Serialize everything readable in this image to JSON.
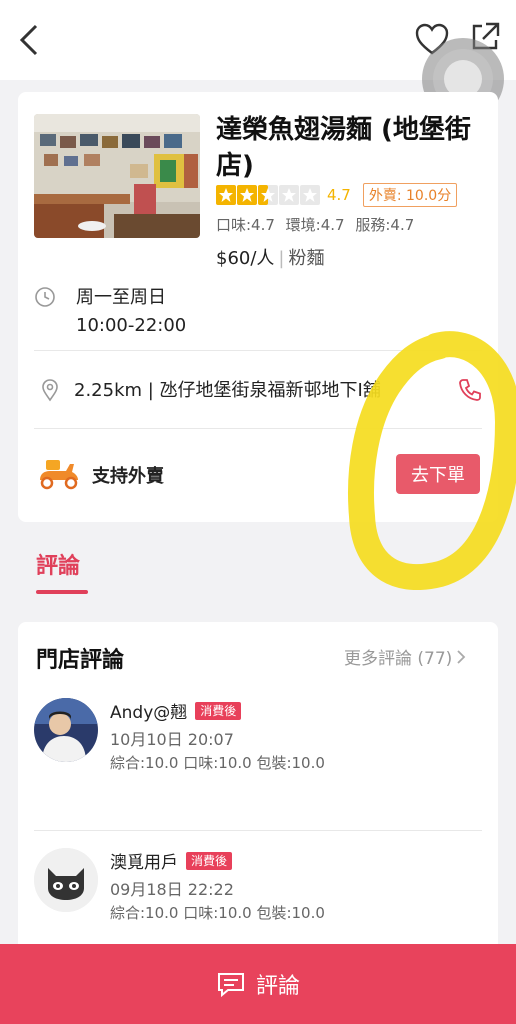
{
  "colors": {
    "accent": "#e0405a",
    "star": "#f4b400",
    "delivery_score": "#e8822a",
    "order_button": "#e85a6a",
    "bottom_bar": "#e8435c",
    "annotation": "#f5dc1e"
  },
  "header": {
    "back_icon": "chevron-left-icon",
    "favorite_icon": "heart-outline-icon",
    "share_icon": "share-icon"
  },
  "shop": {
    "name": "達榮魚翅湯麵 (地堡街店)",
    "rating": "4.7",
    "star_count_filled": 2.5,
    "delivery_score": "外賣: 10.0分",
    "sub_scores": "口味:4.7 環境:4.7 服務:4.7",
    "price": "$60/人",
    "category": "粉麵",
    "hours_line1": "周一至周日",
    "hours_line2": "10:00-22:00",
    "address": "2.25km | 氹仔地堡街泉福新邨地下I舖",
    "delivery_label": "支持外賣",
    "order_button": "去下單"
  },
  "tabs": {
    "reviews": "評論"
  },
  "reviews": {
    "title": "門店評論",
    "more": "更多評論 (77)",
    "items": [
      {
        "name": "Andy@翹",
        "badge": "消費後",
        "time": "10月10日 20:07",
        "scores": "綜合:10.0 口味:10.0 包裝:10.0"
      },
      {
        "name": "澳覓用戶",
        "badge": "消費後",
        "time": "09月18日 22:22",
        "scores": "綜合:10.0 口味:10.0 包裝:10.0"
      }
    ]
  },
  "bottom_bar": {
    "label": "評論",
    "icon": "comment-icon"
  }
}
